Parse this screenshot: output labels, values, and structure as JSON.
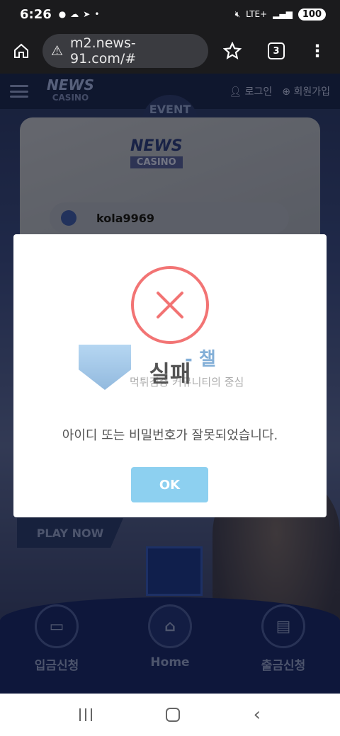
{
  "status_bar": {
    "time": "6:26",
    "notif_icons": [
      "talk-icon",
      "cloud-icon",
      "telegram-icon",
      "dot-icon"
    ],
    "network": "LTE+",
    "battery": "100"
  },
  "browser": {
    "url": "m2.news-91.com/#",
    "tab_count": "3"
  },
  "site": {
    "logo_text": "NEWS",
    "logo_sub": "CASINO",
    "event_tab": "EVENT",
    "login_link": "로그인",
    "signup_link": "회원가입",
    "username_value": "kola9969",
    "play_now": "PLAY NOW",
    "bottom_nav": [
      {
        "label": "입금신청",
        "icon": "deposit-icon"
      },
      {
        "label": "Home",
        "icon": "home-icon"
      },
      {
        "label": "출금신청",
        "icon": "withdraw-icon"
      }
    ]
  },
  "modal": {
    "icon": "error-x-icon",
    "title": "실패",
    "message": "아이디 또는 비밀번호가 잘못되었습니다.",
    "ok_label": "OK",
    "watermark_title": "- 챌",
    "watermark_sub": "먹튀검증 커뮤니티의 중심"
  },
  "colors": {
    "error": "#f27474",
    "ok_button": "#8dd0f0",
    "text": "#545454"
  }
}
